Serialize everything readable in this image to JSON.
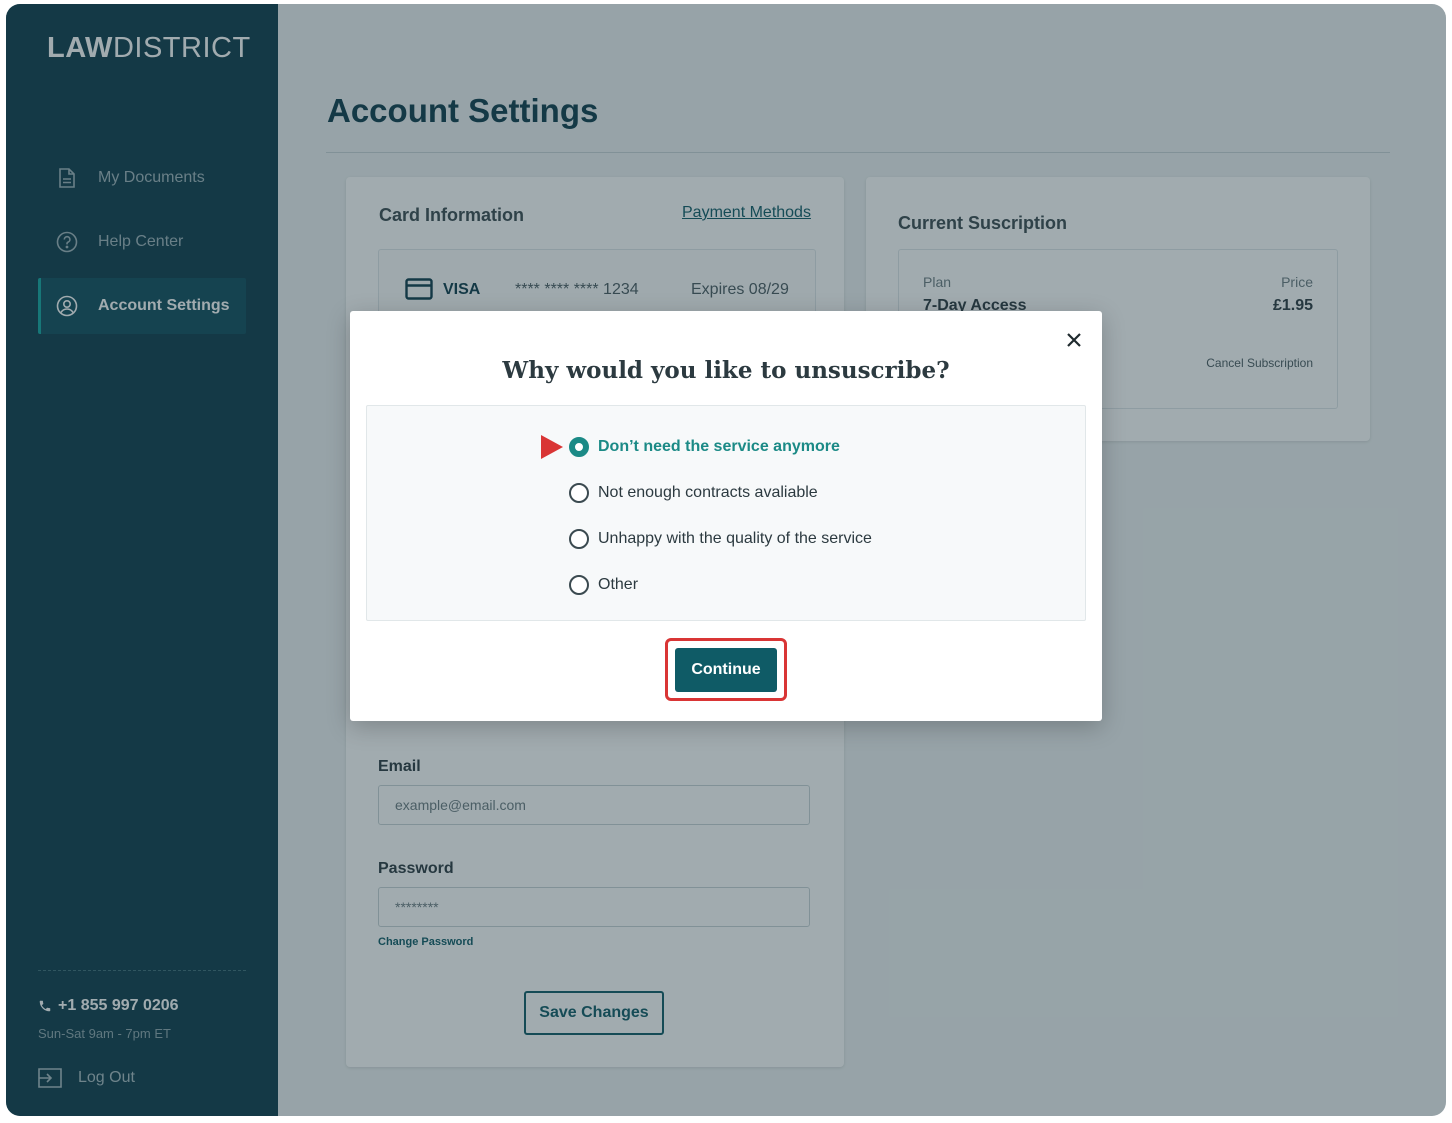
{
  "brand": {
    "logo_bold": "LAW",
    "logo_light": "DISTRICT"
  },
  "sidebar": {
    "items": [
      {
        "label": "My Documents",
        "icon": "document-icon"
      },
      {
        "label": "Help Center",
        "icon": "help-circle-icon"
      },
      {
        "label": "Account Settings",
        "icon": "user-circle-icon",
        "active": true
      }
    ],
    "phone": "+1 855 997 0206",
    "hours": "Sun-Sat 9am - 7pm ET",
    "logout_label": "Log Out"
  },
  "page": {
    "title": "Account Settings"
  },
  "card_info": {
    "heading": "Card Information",
    "payment_methods_link": "Payment Methods",
    "card_brand": "VISA",
    "card_number": "**** **** **** 1234",
    "expires": "Expires 08/29"
  },
  "account": {
    "email_label": "Email",
    "email_placeholder": "example@email.com",
    "password_label": "Password",
    "password_value": "********",
    "change_password_link": "Change Password",
    "save_label": "Save Changes"
  },
  "subscription": {
    "heading": "Current Suscription",
    "plan_label": "Plan",
    "plan_value": "7-Day Access",
    "price_label": "Price",
    "price_value": "£1.95",
    "cancel_link": "Cancel Subscription"
  },
  "modal": {
    "title": "Why would you like to unsuscribe?",
    "options": [
      "Don’t need the service anymore",
      "Not enough contracts avaliable",
      "Unhappy with the quality of the service",
      "Other"
    ],
    "selected_index": 0,
    "continue_label": "Continue"
  },
  "colors": {
    "sidebar_bg": "#0d3b4a",
    "accent": "#0f5b66",
    "selected_teal": "#1b8a86",
    "highlight_red": "#d93535"
  }
}
